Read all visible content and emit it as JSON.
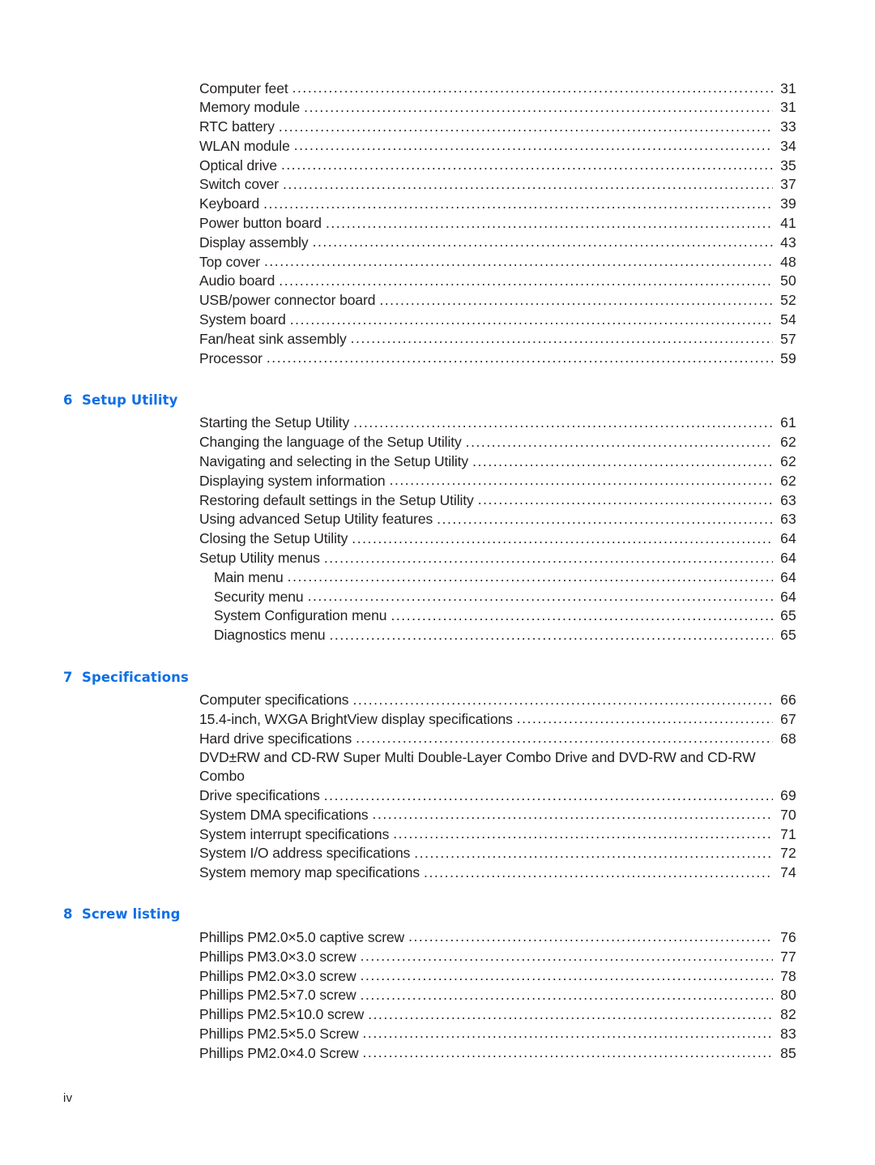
{
  "document": {
    "page_folio": "iv",
    "heading_color": "#0f6fe5",
    "text_color": "#231f20"
  },
  "toc": {
    "groups": [
      {
        "id": "removal-continued",
        "heading": null,
        "entries": [
          {
            "label": "Computer feet",
            "page": "31",
            "level": 1
          },
          {
            "label": "Memory module",
            "page": "31",
            "level": 1
          },
          {
            "label": "RTC battery",
            "page": "33",
            "level": 1
          },
          {
            "label": "WLAN module",
            "page": "34",
            "level": 1
          },
          {
            "label": "Optical drive",
            "page": "35",
            "level": 1
          },
          {
            "label": "Switch cover",
            "page": "37",
            "level": 1
          },
          {
            "label": "Keyboard",
            "page": "39",
            "level": 1
          },
          {
            "label": "Power button board",
            "page": "41",
            "level": 1
          },
          {
            "label": "Display assembly",
            "page": "43",
            "level": 1
          },
          {
            "label": "Top cover",
            "page": "48",
            "level": 1
          },
          {
            "label": "Audio board",
            "page": "50",
            "level": 1
          },
          {
            "label": "USB/power connector board",
            "page": "52",
            "level": 1
          },
          {
            "label": "System board",
            "page": "54",
            "level": 1
          },
          {
            "label": "Fan/heat sink assembly",
            "page": "57",
            "level": 1
          },
          {
            "label": "Processor",
            "page": "59",
            "level": 1
          }
        ]
      },
      {
        "id": "setup-utility",
        "heading": {
          "number": "6",
          "title": "Setup Utility"
        },
        "entries": [
          {
            "label": "Starting the Setup Utility",
            "page": "61",
            "level": 1
          },
          {
            "label": "Changing the language of the Setup Utility",
            "page": "62",
            "level": 1
          },
          {
            "label": "Navigating and selecting in the Setup Utility",
            "page": "62",
            "level": 1
          },
          {
            "label": "Displaying system information",
            "page": "62",
            "level": 1
          },
          {
            "label": "Restoring default settings in the Setup Utility",
            "page": "63",
            "level": 1
          },
          {
            "label": "Using advanced Setup Utility features",
            "page": "63",
            "level": 1
          },
          {
            "label": "Closing the Setup Utility",
            "page": "64",
            "level": 1
          },
          {
            "label": "Setup Utility menus",
            "page": "64",
            "level": 1
          },
          {
            "label": "Main menu",
            "page": "64",
            "level": 2
          },
          {
            "label": "Security menu",
            "page": "64",
            "level": 2
          },
          {
            "label": "System Configuration menu",
            "page": "65",
            "level": 2
          },
          {
            "label": "Diagnostics menu",
            "page": "65",
            "level": 2
          }
        ]
      },
      {
        "id": "specifications",
        "heading": {
          "number": "7",
          "title": "Specifications"
        },
        "entries": [
          {
            "label": "Computer specifications",
            "page": "66",
            "level": 1
          },
          {
            "label": "15.4-inch, WXGA BrightView display specifications",
            "page": "67",
            "level": 1
          },
          {
            "label": "Hard drive specifications",
            "page": "68",
            "level": 1
          },
          {
            "label": "DVD±RW and CD-RW Super Multi Double-Layer Combo Drive and DVD-RW and CD-RW Combo",
            "continuation": "Drive specifications",
            "page": "69",
            "level": 1,
            "wrapped": true
          },
          {
            "label": "System DMA specifications",
            "page": "70",
            "level": 1
          },
          {
            "label": "System interrupt specifications",
            "page": "71",
            "level": 1
          },
          {
            "label": "System I/O address specifications",
            "page": "72",
            "level": 1
          },
          {
            "label": "System memory map specifications",
            "page": "74",
            "level": 1
          }
        ]
      },
      {
        "id": "screw-listing",
        "heading": {
          "number": "8",
          "title": "Screw listing"
        },
        "entries": [
          {
            "label": "Phillips PM2.0×5.0 captive screw",
            "page": "76",
            "level": 1
          },
          {
            "label": "Phillips PM3.0×3.0 screw",
            "page": "77",
            "level": 1
          },
          {
            "label": "Phillips PM2.0×3.0 screw",
            "page": "78",
            "level": 1
          },
          {
            "label": "Phillips PM2.5×7.0 screw",
            "page": "80",
            "level": 1
          },
          {
            "label": "Phillips PM2.5×10.0 screw",
            "page": "82",
            "level": 1
          },
          {
            "label": "Phillips PM2.5×5.0 Screw",
            "page": "83",
            "level": 1
          },
          {
            "label": "Phillips PM2.0×4.0 Screw",
            "page": "85",
            "level": 1
          }
        ]
      }
    ]
  }
}
